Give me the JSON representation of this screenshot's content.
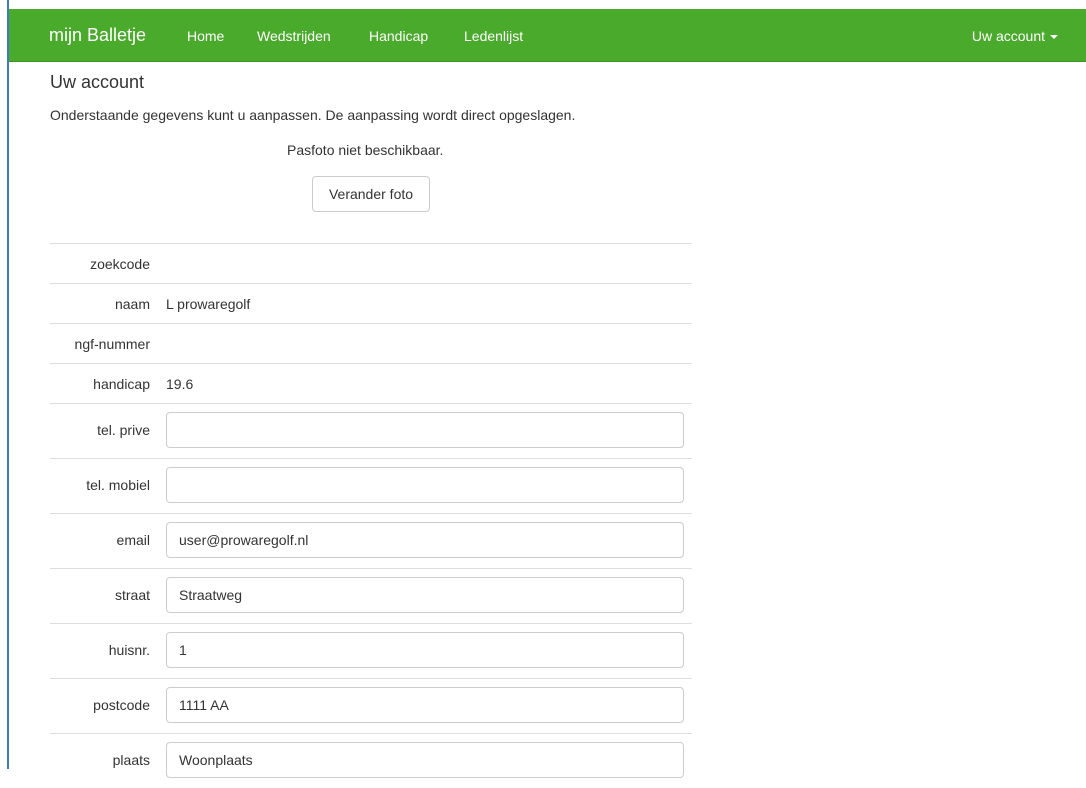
{
  "navbar": {
    "brand": "mijn Balletje",
    "links": [
      "Home",
      "Wedstrijden",
      "Handicap",
      "Ledenlijst"
    ],
    "account_menu": "Uw account",
    "color": "#4aaa2b"
  },
  "page": {
    "title": "Uw account",
    "intro": "Onderstaande gegevens kunt u aanpassen. De aanpassing wordt direct opgeslagen.",
    "photo_message": "Pasfoto niet beschikbaar.",
    "photo_button": "Verander foto"
  },
  "details": {
    "zoekcode": {
      "label": "zoekcode",
      "value": ""
    },
    "naam": {
      "label": "naam",
      "value": "L prowaregolf"
    },
    "ngf": {
      "label": "ngf-nummer",
      "value": ""
    },
    "handicap": {
      "label": "handicap",
      "value": "19.6"
    },
    "tel_prive": {
      "label": "tel. prive",
      "value": ""
    },
    "tel_mobiel": {
      "label": "tel. mobiel",
      "value": ""
    },
    "email": {
      "label": "email",
      "value": "user@prowaregolf.nl"
    },
    "straat": {
      "label": "straat",
      "value": "Straatweg"
    },
    "huisnr": {
      "label": "huisnr.",
      "value": "1"
    },
    "postcode": {
      "label": "postcode",
      "value": "1111 AA"
    },
    "plaats": {
      "label": "plaats",
      "value": "Woonplaats"
    }
  }
}
